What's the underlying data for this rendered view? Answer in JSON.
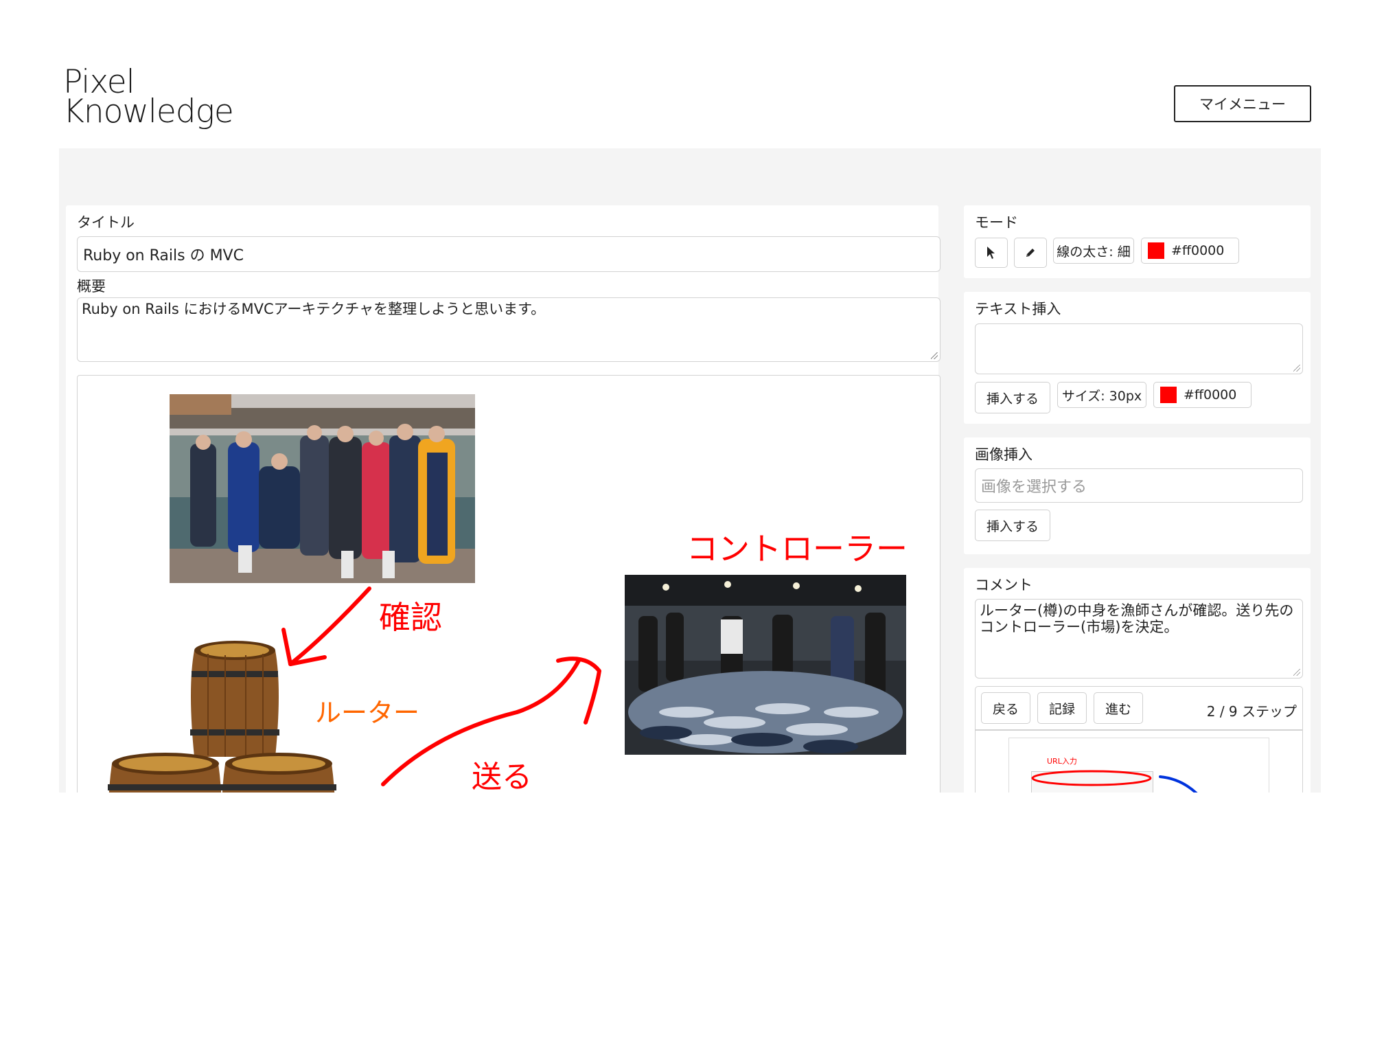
{
  "header": {
    "logo_line1": "Pixel",
    "logo_line2": "Knowledge",
    "menu_label": "マイメニュー"
  },
  "editor": {
    "title_label": "タイトル",
    "title_value": "Ruby on Rails の MVC",
    "summary_label": "概要",
    "summary_value": "Ruby on Rails におけるMVCアーキテクチャを整理しようと思います。"
  },
  "canvas": {
    "annotations": [
      {
        "text": "確認",
        "color": "#ff0000"
      },
      {
        "text": "ルーター",
        "color": "#ff6600"
      },
      {
        "text": "送る",
        "color": "#ff0000"
      },
      {
        "text": "コントローラー",
        "color": "#ff0000"
      }
    ],
    "images": [
      "fishermen-photo",
      "barrels-image",
      "fish-market-photo"
    ]
  },
  "sidebar": {
    "mode": {
      "label": "モード",
      "select_icon": "cursor-icon",
      "pen_icon": "pencil-icon",
      "stroke_width": "線の太さ: 細",
      "color": "#ff0000",
      "color_label": "#ff0000"
    },
    "text_insert": {
      "label": "テキスト挿入",
      "value": "",
      "insert_button": "挿入する",
      "size": "サイズ: 30px",
      "color": "#ff0000",
      "color_label": "#ff0000"
    },
    "image_insert": {
      "label": "画像挿入",
      "placeholder": "画像を選択する",
      "insert_button": "挿入する"
    },
    "comment": {
      "label": "コメント",
      "value": "ルーター(樽)の中身を漁師さんが確認。送り先のコントローラー(市場)を決定。",
      "back_button": "戻る",
      "record_button": "記録",
      "forward_button": "進む",
      "step_counter": "2 / 9 ステップ",
      "thumbnail_note": "URL入力"
    }
  }
}
